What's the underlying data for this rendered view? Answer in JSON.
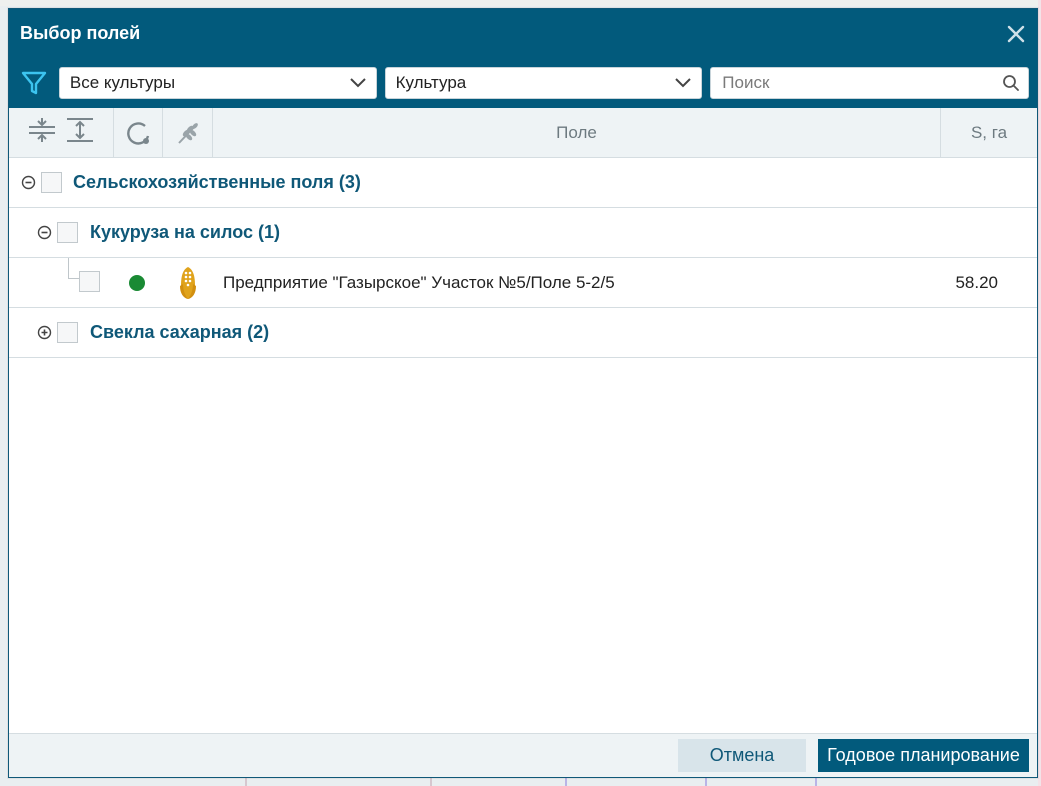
{
  "dialog": {
    "title": "Выбор полей"
  },
  "filters": {
    "culture_filter": "Все культуры",
    "group_by": "Культура",
    "search_placeholder": "Поиск"
  },
  "table": {
    "headers": {
      "field": "Поле",
      "area": "S, га"
    }
  },
  "tree": {
    "root": {
      "label": "Сельскохозяйственные поля (3)",
      "expanded": true
    },
    "groups": [
      {
        "label": "Кукуруза на силос (1)",
        "expanded": true,
        "items": [
          {
            "name": "Предприятие \"Газырское\" Участок №5/Поле 5-2/5",
            "area": "58.20",
            "status_color": "#1a8a34",
            "crop_icon": "corn-icon"
          }
        ]
      },
      {
        "label": "Свекла сахарная (2)",
        "expanded": false,
        "items": []
      }
    ]
  },
  "footer": {
    "cancel_label": "Отмена",
    "primary_label": "Годовое планирование"
  },
  "colors": {
    "header_bg": "#025a7c",
    "accent": "#0f5878",
    "status_green": "#1a8a34",
    "crop_yellow": "#e0a31b"
  }
}
